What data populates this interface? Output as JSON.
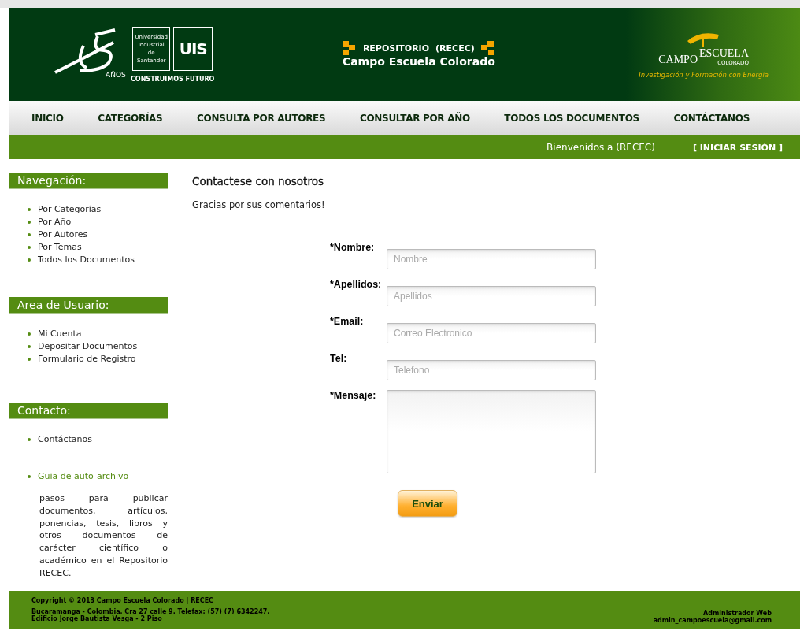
{
  "header": {
    "logo_left": {
      "years_mark": "AÑOS",
      "university": "Universidad Industrial de Santander",
      "monogram": "UIS",
      "motto": "CONSTRUIMOS FUTURO"
    },
    "repository": {
      "label": "REPOSITORIO",
      "abbr": "(RECEC)",
      "name": "Campo Escuela Colorado"
    },
    "logo_right": {
      "word1": "CAMPO",
      "word2": "ESCUELA",
      "word3": "COLORADO",
      "tagline": "Investigación y Formación con Energía"
    }
  },
  "nav": [
    "INICIO",
    "CATEGORÍAS",
    "CONSULTA POR AUTORES",
    "CONSULTAR POR AÑO",
    "TODOS LOS DOCUMENTOS",
    "CONTÁCTANOS"
  ],
  "welcome_bar": {
    "welcome": "Bienvenidos a (RECEC)",
    "login": "[ INICIAR SESIÓN ]"
  },
  "sidebar": [
    {
      "title": "Navegación:",
      "items": [
        {
          "label": "Por Categorías"
        },
        {
          "label": "Por Año"
        },
        {
          "label": "Por Autores"
        },
        {
          "label": "Por Temas"
        },
        {
          "label": "Todos los Documentos"
        }
      ]
    },
    {
      "title": "Area de Usuario:",
      "items": [
        {
          "label": "Mi Cuenta"
        },
        {
          "label": "Depositar Documentos"
        },
        {
          "label": "Formulario de Registro"
        }
      ]
    },
    {
      "title": "Contacto:",
      "items": [
        {
          "label": "Contáctanos"
        },
        {
          "label": "Guia de auto-archivo",
          "highlight": true,
          "description": "pasos para publicar documentos, artículos, ponencias, tesis, libros y otros documentos de carácter científico o académico en el Repositorio RECEC."
        }
      ]
    }
  ],
  "content": {
    "title": "Contactese con nosotros",
    "message": "Gracias por sus comentarios!",
    "form": [
      {
        "label": "*Nombre:",
        "kind": "input",
        "placeholder": "Nombre"
      },
      {
        "label": "*Apellidos:",
        "kind": "input",
        "placeholder": "Apellidos"
      },
      {
        "label": "*Email:",
        "kind": "input",
        "placeholder": "Correo Electronico"
      },
      {
        "label": "Tel:",
        "kind": "input",
        "placeholder": "Telefono"
      },
      {
        "label": "*Mensaje:",
        "kind": "textarea"
      }
    ],
    "submit": "Enviar"
  },
  "footer": {
    "copyright": "Copyright © 2013 Campo Escuela Colorado | RECEC",
    "address": "Bucaramanga - Colombia. Cra 27 calle 9. Telefax: (57) (7) 6342247.",
    "building": "Edificio Jorge Bautista Vesga - 2 Piso",
    "admin_label": "Administrador Web",
    "admin_email": "admin_campoescuela@gmail.com"
  }
}
